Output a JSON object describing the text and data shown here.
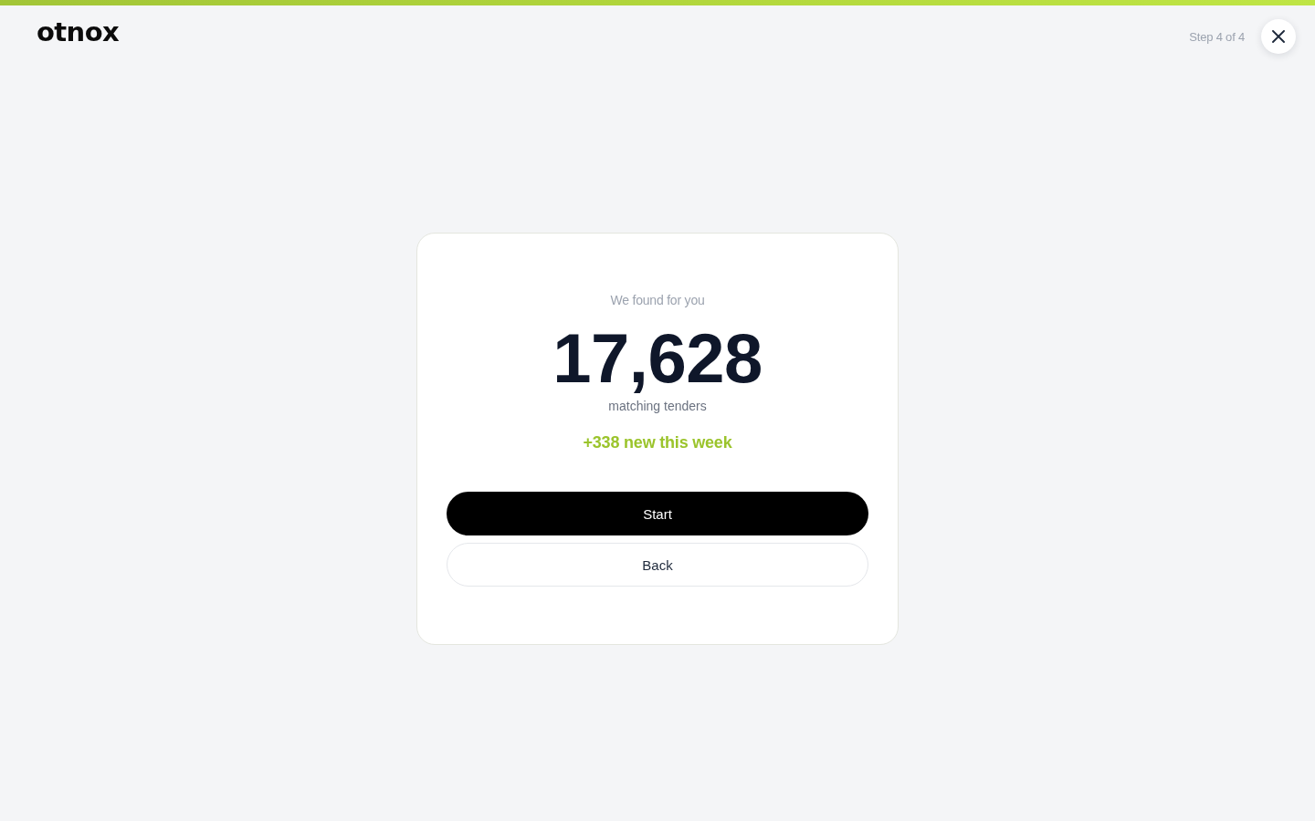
{
  "progress": {
    "level": 1
  },
  "header": {
    "logo": "otnox",
    "step": "Step 4 of 4"
  },
  "card": {
    "intro": "We found for you",
    "count": "17,628",
    "count_label": "matching tenders",
    "delta": "+338 new this week"
  },
  "buttons": [
    {
      "label": "Start",
      "kind": "primary"
    },
    {
      "label": "Back",
      "kind": "secondary"
    }
  ]
}
